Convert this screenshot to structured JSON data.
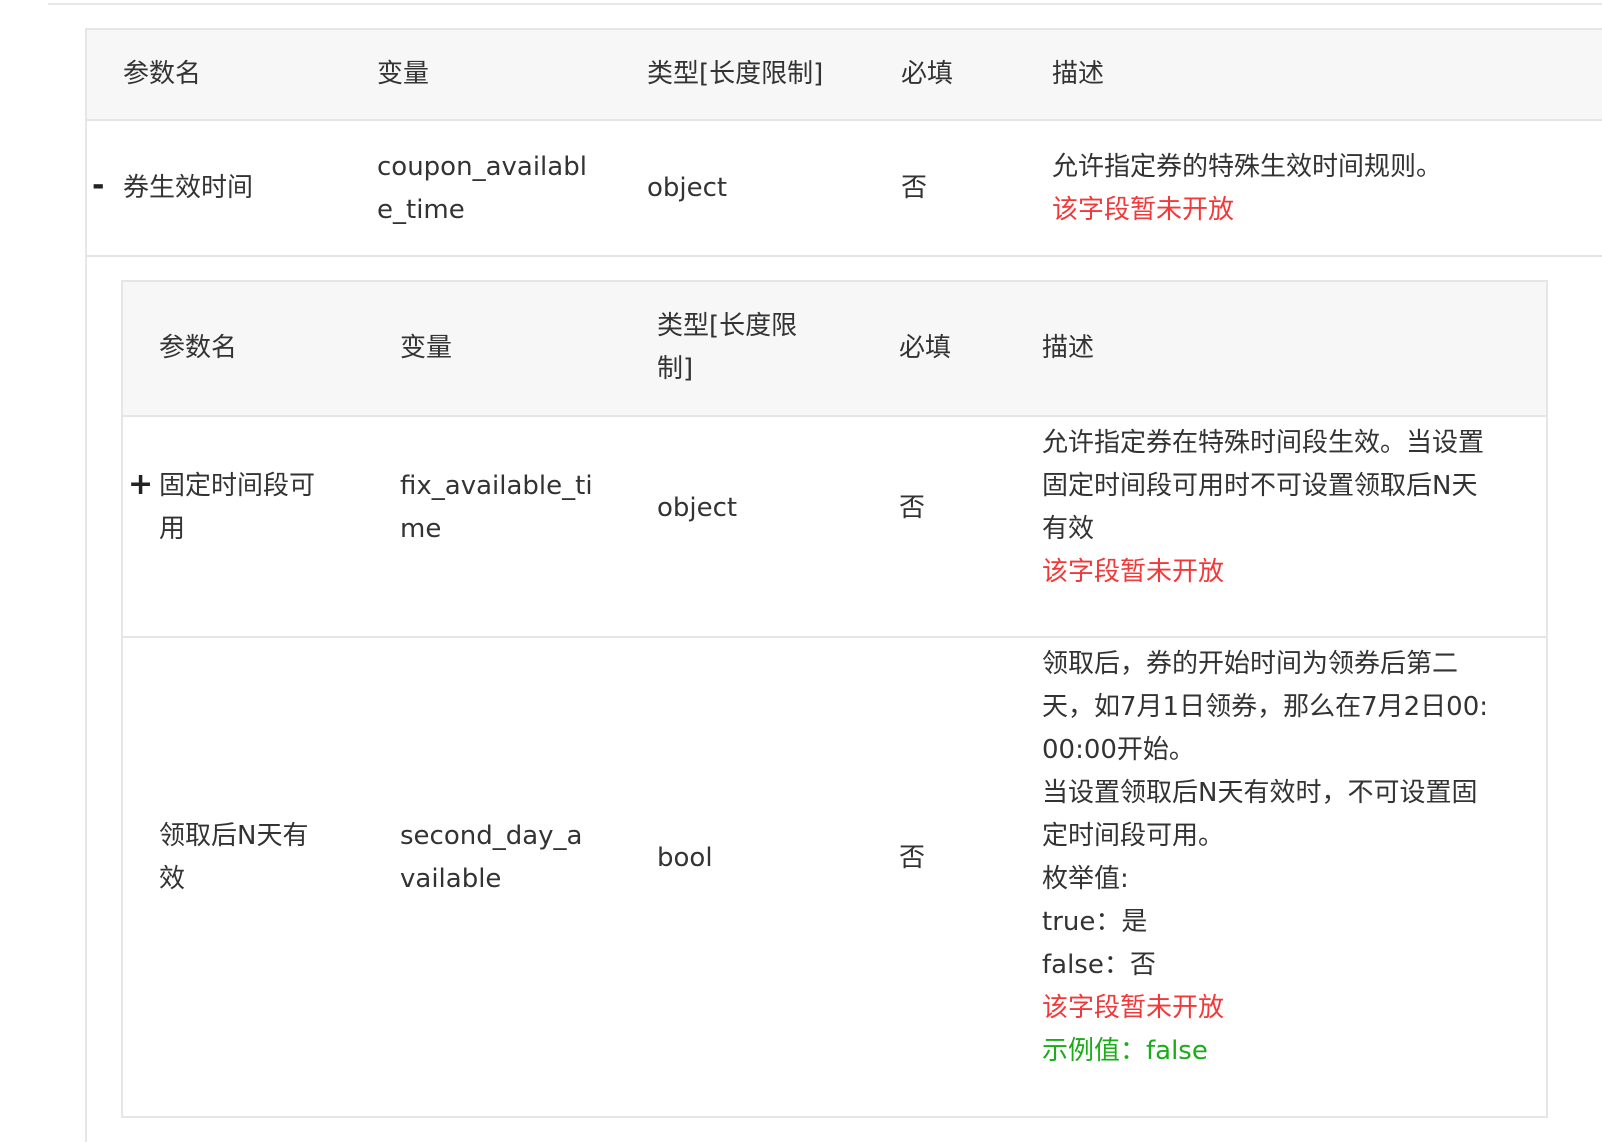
{
  "headers": {
    "name": "参数名",
    "variable": "变量",
    "type": "类型[长度限制]",
    "required": "必填",
    "description": "描述"
  },
  "inner_headers": {
    "name": "参数名",
    "variable": "变量",
    "type_line1": "类型[长度限",
    "type_line2": "制]",
    "required": "必填",
    "description": "描述"
  },
  "row_coupon": {
    "toggle": "-",
    "name": "券生效时间",
    "variable_line1": "coupon_availabl",
    "variable_line2": "e_time",
    "type": "object",
    "required": "否",
    "desc_line1": "允许指定券的特殊生效时间规则。",
    "desc_notice": "该字段暂未开放"
  },
  "row_fix": {
    "toggle": "+",
    "name_line1": "固定时间段可",
    "name_line2": "用",
    "variable_line1": "fix_available_ti",
    "variable_line2": "me",
    "type": "object",
    "required": "否",
    "desc_line1": "允许指定券在特殊时间段生效。当设置",
    "desc_line2": "固定时间段可用时不可设置领取后N天",
    "desc_line3": "有效",
    "desc_notice": "该字段暂未开放"
  },
  "row_second": {
    "name_line1": "领取后N天有",
    "name_line2": "效",
    "variable_line1": "second_day_a",
    "variable_line2": "vailable",
    "type": "bool",
    "required": "否",
    "desc_line1": "领取后，券的开始时间为领券后第二",
    "desc_line2": "天，如7月1日领券，那么在7月2日00:",
    "desc_line3": "00:00开始。",
    "desc_line4": "当设置领取后N天有效时，不可设置固",
    "desc_line5": "定时间段可用。",
    "desc_line6": "枚举值:",
    "desc_line7": "true：是",
    "desc_line8": "false：否",
    "desc_notice": "该字段暂未开放",
    "desc_example": "示例值：false"
  },
  "colors": {
    "notice": "#f2393a",
    "example": "#1aad19",
    "header_bg": "#f7f7f7",
    "border": "#e6e6e6"
  }
}
